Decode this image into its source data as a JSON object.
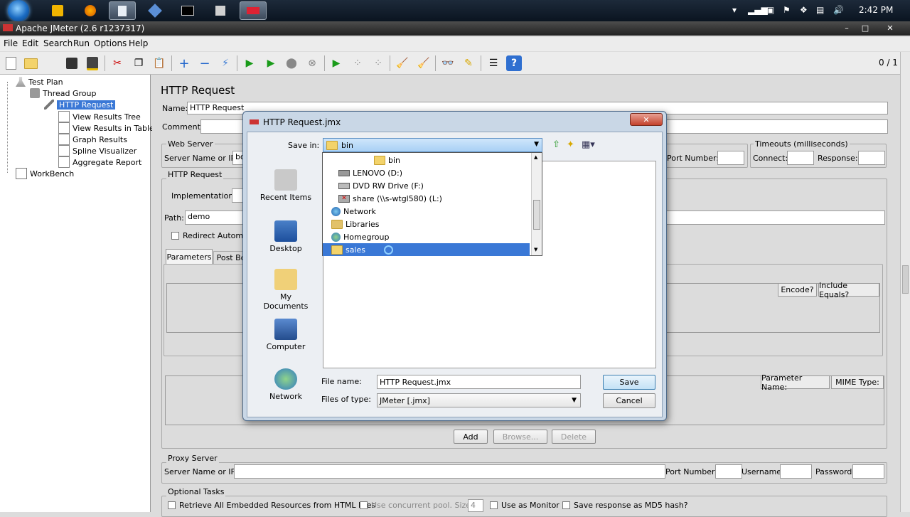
{
  "taskbar": {
    "clock": "2:42 PM",
    "icons": [
      "start-orb",
      "outlook-icon",
      "firefox-icon",
      "notepad-icon",
      "virtualbox-icon",
      "cmd-icon",
      "network-tool-icon",
      "jmeter-icon"
    ],
    "tray_icons": [
      "chevron-up-icon",
      "signal-icon",
      "monitor-icon",
      "flag-icon",
      "dropbox-icon",
      "display-icon",
      "volume-icon"
    ]
  },
  "window": {
    "title": "Apache JMeter (2.6 r1237317)",
    "controls": {
      "minimize": "–",
      "restore": "□",
      "close": "✕"
    }
  },
  "menu": [
    "File",
    "Edit",
    "Search",
    "Run",
    "Options",
    "Help"
  ],
  "toolbar": {
    "counter": "0 / 1",
    "tools": [
      "new-icon",
      "open-icon",
      "save-icon",
      "save-as-icon",
      "cut-icon",
      "copy-icon",
      "paste-icon",
      "add-icon",
      "remove-icon",
      "toggle-icon",
      "start-icon",
      "start-no-pause-icon",
      "stop-icon",
      "shutdown-icon",
      "remote-start-icon",
      "remote-stop-icon",
      "remote-shutdown-icon",
      "clear-icon",
      "clear-all-icon",
      "search-icon",
      "reset-search-icon",
      "function-helper-icon",
      "help-icon"
    ]
  },
  "tree": {
    "items": [
      {
        "label": "Test Plan",
        "level": 1
      },
      {
        "label": "Thread Group",
        "level": 2
      },
      {
        "label": "HTTP Request",
        "level": 3,
        "selected": true
      },
      {
        "label": "View Results Tree",
        "level": 4
      },
      {
        "label": "View Results in Table",
        "level": 4
      },
      {
        "label": "Graph Results",
        "level": 4
      },
      {
        "label": "Spline Visualizer",
        "level": 4
      },
      {
        "label": "Aggregate Report",
        "level": 4
      },
      {
        "label": "WorkBench",
        "level": 1
      }
    ]
  },
  "main": {
    "title": "HTTP Request",
    "name_label": "Name:",
    "name_value": "HTTP Request",
    "comments_label": "Comments:",
    "web_server": {
      "title": "Web Server",
      "server_label": "Server Name or IP:",
      "server_value": "bo",
      "port_label": "Port Number:"
    },
    "timeouts": {
      "title": "Timeouts (milliseconds)",
      "connect_label": "Connect:",
      "response_label": "Response:"
    },
    "http_request": {
      "title": "HTTP Request",
      "implementation_label": "Implementation:",
      "path_label": "Path:",
      "path_value": "demo",
      "redirect_label": "Redirect Automati"
    },
    "tabs": [
      "Parameters",
      "Post Bo"
    ],
    "params_cols": [
      "Encode?",
      "Include Equals?"
    ],
    "files_cols": [
      "Parameter Name:",
      "MIME Type:"
    ],
    "buttons": {
      "add": "Add",
      "browse": "Browse...",
      "delete": "Delete"
    },
    "proxy": {
      "title": "Proxy Server",
      "server_label": "Server Name or IP:",
      "port_label": "Port Number:",
      "username_label": "Username",
      "password_label": "Password"
    },
    "optional": {
      "title": "Optional Tasks",
      "retrieve_label": "Retrieve All Embedded Resources from HTML Files",
      "concurrent_label": "Use concurrent pool. Size:",
      "pool_size": "4",
      "monitor_label": "Use as Monitor",
      "md5_label": "Save response as MD5 hash?"
    }
  },
  "dialog": {
    "title": "HTTP Request.jmx",
    "save_in_label": "Save in:",
    "save_in_value": "bin",
    "places": [
      "Recent Items",
      "Desktop",
      "My Documents",
      "Computer",
      "Network"
    ],
    "dropdown_items": [
      {
        "label": "bin",
        "icon": "folder-icon"
      },
      {
        "label": "LENOVO (D:)",
        "icon": "drive-icon"
      },
      {
        "label": "DVD RW Drive (F:)",
        "icon": "dvd-icon"
      },
      {
        "label": "share (\\\\s-wtgl580) (L:)",
        "icon": "network-drive-icon"
      },
      {
        "label": "Network",
        "icon": "network-icon"
      },
      {
        "label": "Libraries",
        "icon": "libraries-icon"
      },
      {
        "label": "Homegroup",
        "icon": "homegroup-icon"
      },
      {
        "label": "sales",
        "icon": "folder-icon",
        "selected": true
      }
    ],
    "file_name_label": "File name:",
    "file_name_value": "HTTP Request.jmx",
    "file_type_label": "Files of type:",
    "file_type_value": "JMeter [.jmx]",
    "save_button": "Save",
    "cancel_button": "Cancel",
    "close": "✕"
  }
}
